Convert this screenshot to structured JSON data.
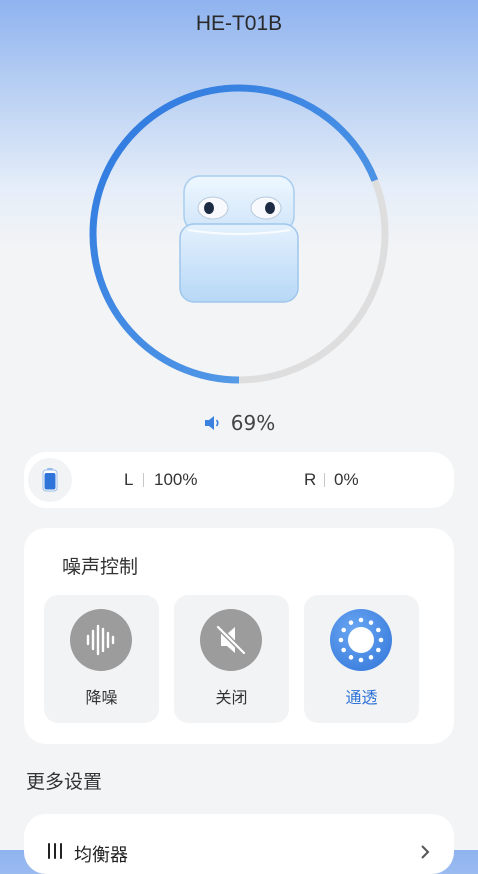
{
  "header": {
    "device_name": "HE-T01B"
  },
  "ring": {
    "progress": 0.69,
    "active_color_start": "#3f86e3",
    "active_color_end": "#78b7e8",
    "track_color": "#dedede"
  },
  "volume": {
    "icon": "speaker-icon",
    "value": "69%"
  },
  "battery": {
    "icon": "battery-icon",
    "left_label": "L",
    "left_value": "100%",
    "right_label": "R",
    "right_value": "0%"
  },
  "noise_control": {
    "title": "噪声控制",
    "modes": [
      {
        "label": "降噪",
        "icon": "noise-cancel-icon",
        "active": false
      },
      {
        "label": "关闭",
        "icon": "mute-off-icon",
        "active": false
      },
      {
        "label": "通透",
        "icon": "transparency-icon",
        "active": true
      }
    ],
    "accent": "#2f74d8"
  },
  "more_settings": {
    "title": "更多设置",
    "items": [
      {
        "label": "均衡器",
        "icon": "equalizer-icon"
      }
    ]
  }
}
